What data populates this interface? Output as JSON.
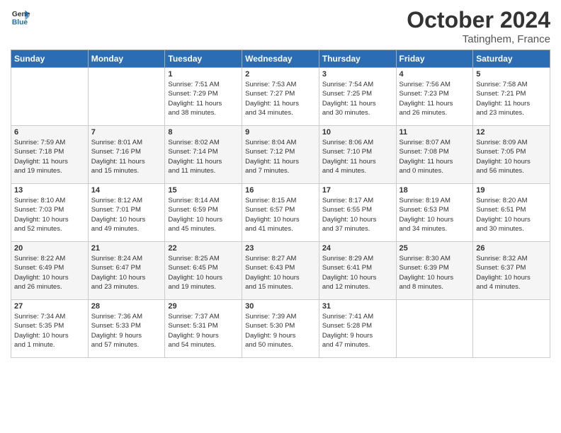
{
  "header": {
    "logo_line1": "General",
    "logo_line2": "Blue",
    "month": "October 2024",
    "location": "Tatinghem, France"
  },
  "weekdays": [
    "Sunday",
    "Monday",
    "Tuesday",
    "Wednesday",
    "Thursday",
    "Friday",
    "Saturday"
  ],
  "weeks": [
    [
      {
        "day": "",
        "content": ""
      },
      {
        "day": "",
        "content": ""
      },
      {
        "day": "1",
        "content": "Sunrise: 7:51 AM\nSunset: 7:29 PM\nDaylight: 11 hours\nand 38 minutes."
      },
      {
        "day": "2",
        "content": "Sunrise: 7:53 AM\nSunset: 7:27 PM\nDaylight: 11 hours\nand 34 minutes."
      },
      {
        "day": "3",
        "content": "Sunrise: 7:54 AM\nSunset: 7:25 PM\nDaylight: 11 hours\nand 30 minutes."
      },
      {
        "day": "4",
        "content": "Sunrise: 7:56 AM\nSunset: 7:23 PM\nDaylight: 11 hours\nand 26 minutes."
      },
      {
        "day": "5",
        "content": "Sunrise: 7:58 AM\nSunset: 7:21 PM\nDaylight: 11 hours\nand 23 minutes."
      }
    ],
    [
      {
        "day": "6",
        "content": "Sunrise: 7:59 AM\nSunset: 7:18 PM\nDaylight: 11 hours\nand 19 minutes."
      },
      {
        "day": "7",
        "content": "Sunrise: 8:01 AM\nSunset: 7:16 PM\nDaylight: 11 hours\nand 15 minutes."
      },
      {
        "day": "8",
        "content": "Sunrise: 8:02 AM\nSunset: 7:14 PM\nDaylight: 11 hours\nand 11 minutes."
      },
      {
        "day": "9",
        "content": "Sunrise: 8:04 AM\nSunset: 7:12 PM\nDaylight: 11 hours\nand 7 minutes."
      },
      {
        "day": "10",
        "content": "Sunrise: 8:06 AM\nSunset: 7:10 PM\nDaylight: 11 hours\nand 4 minutes."
      },
      {
        "day": "11",
        "content": "Sunrise: 8:07 AM\nSunset: 7:08 PM\nDaylight: 11 hours\nand 0 minutes."
      },
      {
        "day": "12",
        "content": "Sunrise: 8:09 AM\nSunset: 7:05 PM\nDaylight: 10 hours\nand 56 minutes."
      }
    ],
    [
      {
        "day": "13",
        "content": "Sunrise: 8:10 AM\nSunset: 7:03 PM\nDaylight: 10 hours\nand 52 minutes."
      },
      {
        "day": "14",
        "content": "Sunrise: 8:12 AM\nSunset: 7:01 PM\nDaylight: 10 hours\nand 49 minutes."
      },
      {
        "day": "15",
        "content": "Sunrise: 8:14 AM\nSunset: 6:59 PM\nDaylight: 10 hours\nand 45 minutes."
      },
      {
        "day": "16",
        "content": "Sunrise: 8:15 AM\nSunset: 6:57 PM\nDaylight: 10 hours\nand 41 minutes."
      },
      {
        "day": "17",
        "content": "Sunrise: 8:17 AM\nSunset: 6:55 PM\nDaylight: 10 hours\nand 37 minutes."
      },
      {
        "day": "18",
        "content": "Sunrise: 8:19 AM\nSunset: 6:53 PM\nDaylight: 10 hours\nand 34 minutes."
      },
      {
        "day": "19",
        "content": "Sunrise: 8:20 AM\nSunset: 6:51 PM\nDaylight: 10 hours\nand 30 minutes."
      }
    ],
    [
      {
        "day": "20",
        "content": "Sunrise: 8:22 AM\nSunset: 6:49 PM\nDaylight: 10 hours\nand 26 minutes."
      },
      {
        "day": "21",
        "content": "Sunrise: 8:24 AM\nSunset: 6:47 PM\nDaylight: 10 hours\nand 23 minutes."
      },
      {
        "day": "22",
        "content": "Sunrise: 8:25 AM\nSunset: 6:45 PM\nDaylight: 10 hours\nand 19 minutes."
      },
      {
        "day": "23",
        "content": "Sunrise: 8:27 AM\nSunset: 6:43 PM\nDaylight: 10 hours\nand 15 minutes."
      },
      {
        "day": "24",
        "content": "Sunrise: 8:29 AM\nSunset: 6:41 PM\nDaylight: 10 hours\nand 12 minutes."
      },
      {
        "day": "25",
        "content": "Sunrise: 8:30 AM\nSunset: 6:39 PM\nDaylight: 10 hours\nand 8 minutes."
      },
      {
        "day": "26",
        "content": "Sunrise: 8:32 AM\nSunset: 6:37 PM\nDaylight: 10 hours\nand 4 minutes."
      }
    ],
    [
      {
        "day": "27",
        "content": "Sunrise: 7:34 AM\nSunset: 5:35 PM\nDaylight: 10 hours\nand 1 minute."
      },
      {
        "day": "28",
        "content": "Sunrise: 7:36 AM\nSunset: 5:33 PM\nDaylight: 9 hours\nand 57 minutes."
      },
      {
        "day": "29",
        "content": "Sunrise: 7:37 AM\nSunset: 5:31 PM\nDaylight: 9 hours\nand 54 minutes."
      },
      {
        "day": "30",
        "content": "Sunrise: 7:39 AM\nSunset: 5:30 PM\nDaylight: 9 hours\nand 50 minutes."
      },
      {
        "day": "31",
        "content": "Sunrise: 7:41 AM\nSunset: 5:28 PM\nDaylight: 9 hours\nand 47 minutes."
      },
      {
        "day": "",
        "content": ""
      },
      {
        "day": "",
        "content": ""
      }
    ]
  ]
}
